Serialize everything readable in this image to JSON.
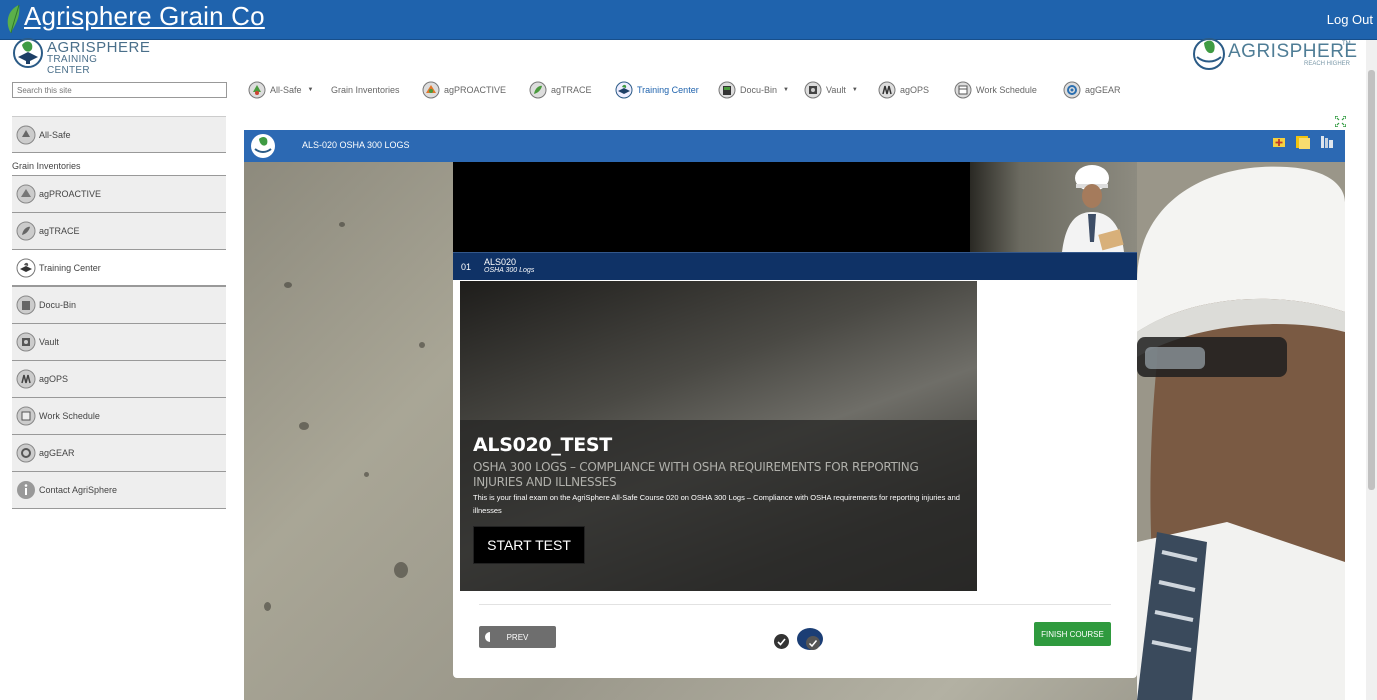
{
  "header": {
    "brand": "Agrisphere Grain Co",
    "logout": "Log Out"
  },
  "logo_left": {
    "line1": "AGRISPHERE",
    "line2": "TRAINING CENTER"
  },
  "logo_right": {
    "line1": "AGRISPHERE",
    "tm": "TM",
    "line2": "REACH HIGHER"
  },
  "search": {
    "placeholder": "Search this site"
  },
  "topnav": [
    {
      "label": "All-Safe",
      "icon": "all-safe-icon",
      "caret": true
    },
    {
      "label": "Grain Inventories",
      "icon": "",
      "caret": false
    },
    {
      "label": "agPROACTIVE",
      "icon": "agproactive-icon",
      "caret": false
    },
    {
      "label": "agTRACE",
      "icon": "agtrace-icon",
      "caret": false
    },
    {
      "label": "Training Center",
      "icon": "training-center-icon",
      "caret": false,
      "active": true
    },
    {
      "label": "Docu-Bin",
      "icon": "docu-bin-icon",
      "caret": true
    },
    {
      "label": "Vault",
      "icon": "vault-icon",
      "caret": true
    },
    {
      "label": "agOPS",
      "icon": "agops-icon",
      "caret": false
    },
    {
      "label": "Work Schedule",
      "icon": "work-schedule-icon",
      "caret": false
    },
    {
      "label": "agGEAR",
      "icon": "aggear-icon",
      "caret": false
    }
  ],
  "sidebar": {
    "items": [
      {
        "label": "All-Safe"
      },
      {
        "label": "Grain Inventories"
      },
      {
        "label": "agPROACTIVE"
      },
      {
        "label": "agTRACE"
      },
      {
        "label": "Training Center"
      },
      {
        "label": "Docu-Bin"
      },
      {
        "label": "Vault"
      },
      {
        "label": "agOPS"
      },
      {
        "label": "Work Schedule"
      },
      {
        "label": "agGEAR"
      },
      {
        "label": "Contact AgriSphere"
      }
    ]
  },
  "course": {
    "title": "ALS-020 OSHA 300 LOGS",
    "lesson_number": "01",
    "lesson_code": "ALS020",
    "lesson_subtitle": "OSHA 300 Logs",
    "slide_title": "ALS020_TEST",
    "slide_subtitle": "OSHA 300 LOGS – COMPLIANCE WITH OSHA REQUIREMENTS FOR REPORTING INJURIES AND ILLNESSES",
    "slide_description": "This is your final exam on the AgriSphere All-Safe Course 020 on OSHA 300 Logs  – Compliance with OSHA requirements for reporting injuries and illnesses",
    "start_button": "START TEST",
    "prev_button": "PREV",
    "finish_button": "FINISH COURSE"
  },
  "colors": {
    "header_blue": "#1f63ad",
    "course_bar": "#2c69b3",
    "lesson_bar": "#0f3266",
    "finish_green": "#2f9a3e"
  }
}
